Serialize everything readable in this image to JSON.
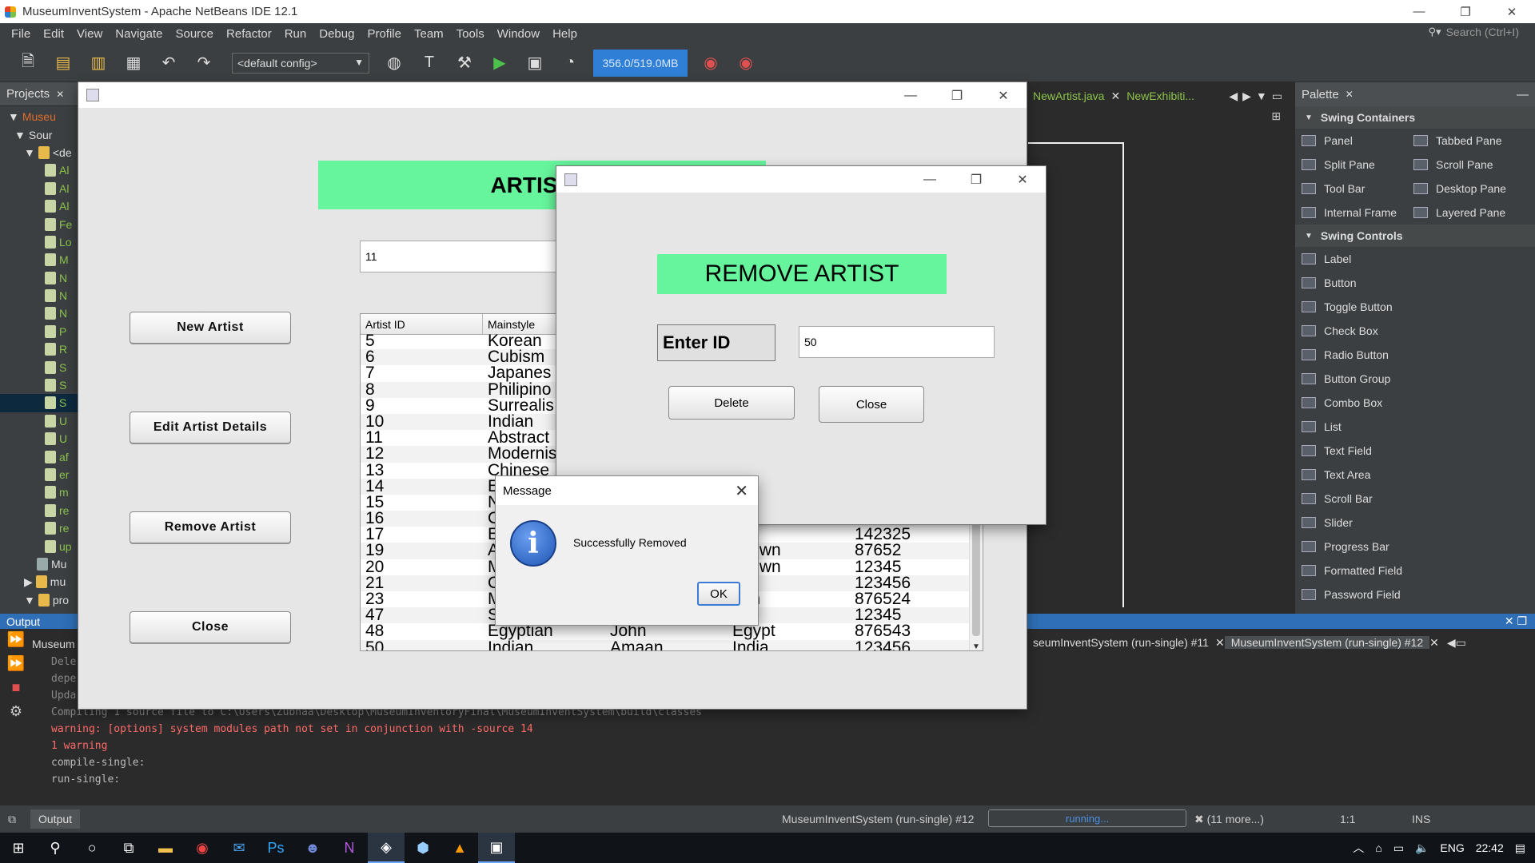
{
  "window": {
    "title": "MuseumInventSystem - Apache NetBeans IDE 12.1",
    "min": "—",
    "restore": "❐",
    "close": "✕"
  },
  "menu": [
    "File",
    "Edit",
    "View",
    "Navigate",
    "Source",
    "Refactor",
    "Run",
    "Debug",
    "Profile",
    "Team",
    "Tools",
    "Window",
    "Help"
  ],
  "search": {
    "placeholder": "Search (Ctrl+I)"
  },
  "toolbar": {
    "config": "<default config>",
    "memory": "356.0/519.0MB"
  },
  "projects": {
    "title": "Projects",
    "rows": [
      "Museu",
      "Sour",
      "<de",
      "Al",
      "Al",
      "Al",
      "Fe",
      "Lo",
      "M",
      "N",
      "N",
      "N",
      "P",
      "R",
      "S",
      "S",
      "S",
      "U",
      "U",
      "af",
      "er",
      "m",
      "re",
      "re",
      "up",
      "Mu",
      "mu",
      "pro"
    ]
  },
  "editor_tabs": [
    "NewArtist.java",
    "NewExhibiti..."
  ],
  "palette": {
    "title": "Palette",
    "containers_title": "Swing Containers",
    "containers": [
      "Panel",
      "Tabbed Pane",
      "Split Pane",
      "Scroll Pane",
      "Tool Bar",
      "Desktop Pane",
      "Internal Frame",
      "Layered Pane"
    ],
    "controls_title": "Swing Controls",
    "controls": [
      "Label",
      "Button",
      "Toggle Button",
      "Check Box",
      "Radio Button",
      "Button Group",
      "Combo Box",
      "List",
      "Text Field",
      "Text Area",
      "Scroll Bar",
      "Slider",
      "Progress Bar",
      "Formatted Field",
      "Password Field"
    ]
  },
  "artist_frame": {
    "header": "ARTIST D",
    "search_value": "11",
    "buttons": {
      "new_artist": "New Artist",
      "edit_artist": "Edit Artist Details",
      "remove_artist": "Remove Artist",
      "close": "Close"
    },
    "table": {
      "columns": [
        "Artist ID",
        "Mainstyle",
        "",
        "",
        ""
      ],
      "rows": [
        [
          "5",
          "Korean",
          "",
          "",
          ""
        ],
        [
          "6",
          "Cubism",
          "",
          "",
          ""
        ],
        [
          "7",
          "Japanes",
          "",
          "",
          ""
        ],
        [
          "8",
          "Philipino",
          "",
          "",
          ""
        ],
        [
          "9",
          "Surrealis",
          "",
          "",
          ""
        ],
        [
          "10",
          "Indian",
          "",
          "",
          ""
        ],
        [
          "11",
          "Abstract",
          "",
          "",
          ""
        ],
        [
          "12",
          "Modernis",
          "",
          "",
          ""
        ],
        [
          "13",
          "Chinese",
          "",
          "",
          ""
        ],
        [
          "14",
          "E",
          "",
          "",
          ""
        ],
        [
          "15",
          "N",
          "",
          "",
          ""
        ],
        [
          "16",
          "C",
          "",
          "",
          ""
        ],
        [
          "17",
          "E",
          "",
          "ypt",
          "142325"
        ],
        [
          "19",
          "A",
          "",
          "known",
          "87652"
        ],
        [
          "20",
          "M",
          "",
          "known",
          "12345"
        ],
        [
          "21",
          "C",
          "",
          "ria",
          "123456"
        ],
        [
          "23",
          "M",
          "",
          "pan",
          "876524"
        ],
        [
          "47",
          "S",
          "",
          "a",
          "12345"
        ],
        [
          "48",
          "Egyptian",
          "John",
          "Egypt",
          "876543"
        ],
        [
          "50",
          "Indian",
          "Amaan",
          "India",
          "123456"
        ]
      ]
    }
  },
  "remove_frame": {
    "header": "REMOVE ARTIST",
    "label": "Enter ID",
    "id_value": "50",
    "delete": "Delete",
    "close": "Close"
  },
  "message": {
    "title": "Message",
    "icon": "i",
    "text": "Successfully Removed",
    "ok": "OK"
  },
  "output": {
    "title": "Output",
    "project_tab": "Museum",
    "run_tabs": [
      "seumInventSystem (run-single) #11",
      "MuseumInventSystem (run-single) #12"
    ],
    "lines": [
      "Dele",
      "depe",
      "Upda",
      "Compiling 1 source file to C:\\Users\\Zubnaa\\Desktop\\MuseumInventoryFinal\\MuseumInventSystem\\build\\classes",
      "warning: [options] system modules path not set in conjunction with -source 14",
      "1 warning",
      "compile-single:",
      "run-single:"
    ]
  },
  "status": {
    "output_btn": "Output",
    "run_info": "MuseumInventSystem (run-single) #12",
    "progress": "running...",
    "more": "(11 more...)",
    "position": "1:1",
    "mode": "INS"
  },
  "taskbar": {
    "lang": "ENG",
    "time": "22:42"
  }
}
